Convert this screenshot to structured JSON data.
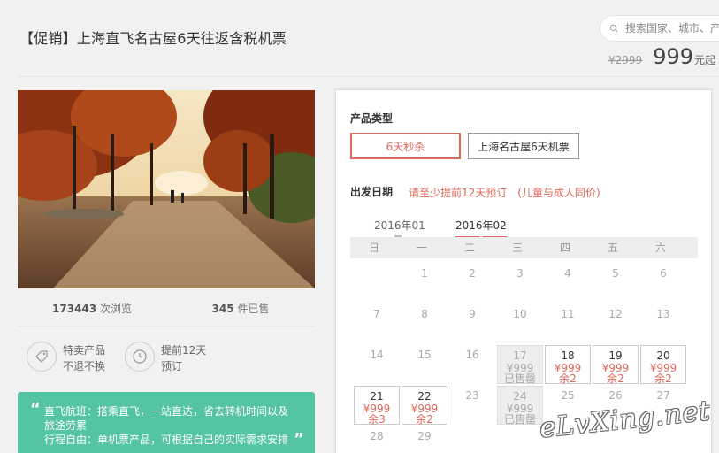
{
  "header": {
    "title": "【促销】上海直飞名古屋6天往返含税机票",
    "search_placeholder": "搜索国家、城市、产",
    "old_price": "¥2999",
    "price": "999",
    "price_suffix": "元起"
  },
  "stats": {
    "views_count": "173443",
    "views_label": "次浏览",
    "sold_count": "345",
    "sold_label": "件已售"
  },
  "features": [
    {
      "icon": "tag-icon",
      "line1": "特卖产品",
      "line2": "不退不换"
    },
    {
      "icon": "clock-icon",
      "line1": "提前12天",
      "line2": "预订"
    }
  ],
  "promo": {
    "open_quote": "“",
    "close_quote": "”",
    "line1": "直飞航班：搭乘直飞，一站直达，省去转机时间以及",
    "line2": "旅途劳累",
    "line3": "行程自由：单机票产品，可根据自己的实际需求安排"
  },
  "booking": {
    "product_type_label": "产品类型",
    "options": [
      "6天秒杀",
      "上海名古屋6天机票"
    ],
    "selected_option": "6天秒杀",
    "date_label": "出发日期",
    "date_note": "请至少提前12天预订　(儿童与成人同价)",
    "months": [
      "2016年01",
      "2016年02"
    ],
    "active_month": "2016年02",
    "weekdays": [
      "日",
      "一",
      "二",
      "三",
      "四",
      "五",
      "六"
    ],
    "calendar": [
      {
        "day": "1",
        "col": 1,
        "row": 0,
        "state": "plain"
      },
      {
        "day": "2",
        "col": 2,
        "row": 0,
        "state": "plain"
      },
      {
        "day": "3",
        "col": 3,
        "row": 0,
        "state": "plain"
      },
      {
        "day": "4",
        "col": 4,
        "row": 0,
        "state": "plain"
      },
      {
        "day": "5",
        "col": 5,
        "row": 0,
        "state": "plain"
      },
      {
        "day": "6",
        "col": 6,
        "row": 0,
        "state": "plain"
      },
      {
        "day": "7",
        "col": 0,
        "row": 1,
        "state": "plain"
      },
      {
        "day": "8",
        "col": 1,
        "row": 1,
        "state": "plain"
      },
      {
        "day": "9",
        "col": 2,
        "row": 1,
        "state": "plain"
      },
      {
        "day": "10",
        "col": 3,
        "row": 1,
        "state": "plain"
      },
      {
        "day": "11",
        "col": 4,
        "row": 1,
        "state": "plain"
      },
      {
        "day": "12",
        "col": 5,
        "row": 1,
        "state": "plain"
      },
      {
        "day": "13",
        "col": 6,
        "row": 1,
        "state": "plain"
      },
      {
        "day": "14",
        "col": 0,
        "row": 2,
        "state": "plain"
      },
      {
        "day": "15",
        "col": 1,
        "row": 2,
        "state": "plain"
      },
      {
        "day": "16",
        "col": 2,
        "row": 2,
        "state": "plain"
      },
      {
        "day": "17",
        "col": 3,
        "row": 2,
        "state": "sold",
        "price": "¥999",
        "status": "已售罄"
      },
      {
        "day": "18",
        "col": 4,
        "row": 2,
        "state": "avail",
        "price": "¥999",
        "status": "余2"
      },
      {
        "day": "19",
        "col": 5,
        "row": 2,
        "state": "avail",
        "price": "¥999",
        "status": "余2"
      },
      {
        "day": "20",
        "col": 6,
        "row": 2,
        "state": "avail",
        "price": "¥999",
        "status": "余2"
      },
      {
        "day": "21",
        "col": 0,
        "row": 3,
        "state": "avail",
        "price": "¥999",
        "status": "余3"
      },
      {
        "day": "22",
        "col": 1,
        "row": 3,
        "state": "avail",
        "price": "¥999",
        "status": "余2"
      },
      {
        "day": "23",
        "col": 2,
        "row": 3,
        "state": "plain"
      },
      {
        "day": "24",
        "col": 3,
        "row": 3,
        "state": "sold",
        "price": "¥999",
        "status": "已售罄"
      },
      {
        "day": "25",
        "col": 4,
        "row": 3,
        "state": "plain"
      },
      {
        "day": "26",
        "col": 5,
        "row": 3,
        "state": "plain"
      },
      {
        "day": "27",
        "col": 6,
        "row": 3,
        "state": "plain"
      },
      {
        "day": "28",
        "col": 0,
        "row": 4,
        "state": "plain"
      },
      {
        "day": "29",
        "col": 1,
        "row": 4,
        "state": "plain"
      }
    ]
  },
  "watermark": "eLvXing.net",
  "colors": {
    "accent": "#e2685a",
    "promo_bg": "#55c4a5"
  }
}
